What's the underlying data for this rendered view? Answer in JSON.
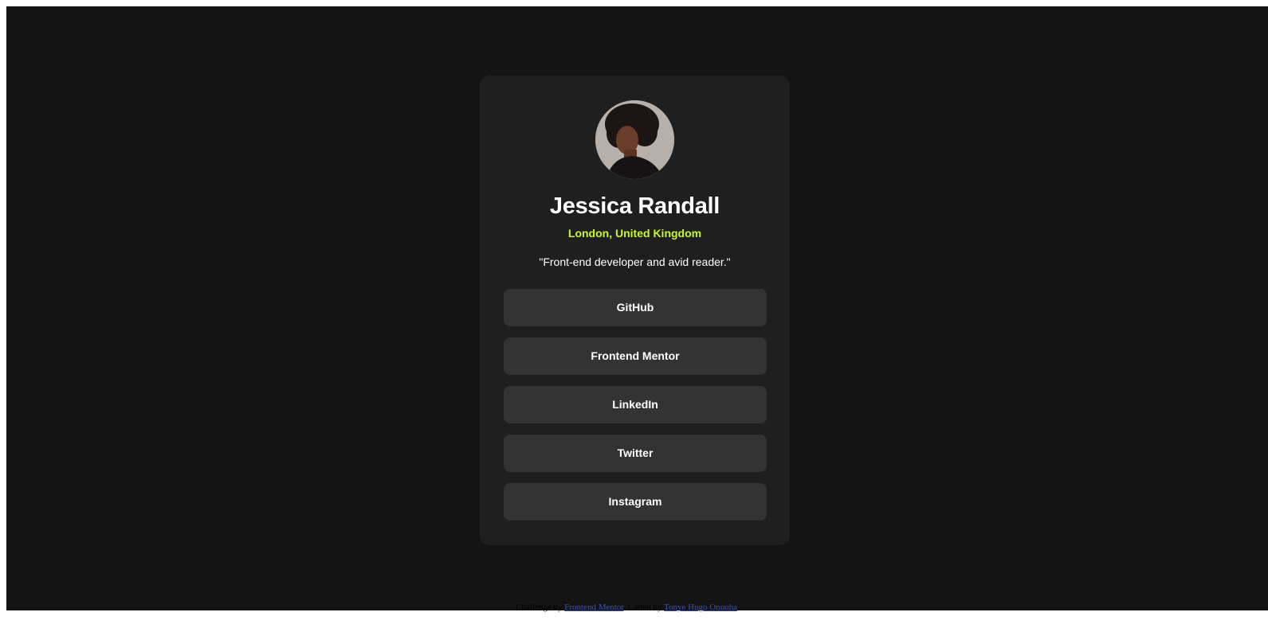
{
  "profile": {
    "name": "Jessica Randall",
    "location": "London, United Kingdom",
    "bio": "\"Front-end developer and avid reader.\""
  },
  "links": [
    {
      "label": "GitHub"
    },
    {
      "label": "Frontend Mentor"
    },
    {
      "label": "LinkedIn"
    },
    {
      "label": "Twitter"
    },
    {
      "label": "Instagram"
    }
  ],
  "footer": {
    "prefix": "Challenge by",
    "challenge_link": "Frontend Mentor",
    "middle": ". Coded by",
    "author_link": "Tonye Hugo Onuoha",
    "suffix": "."
  },
  "colors": {
    "page_background": "#141414",
    "card_background": "#1f1f1f",
    "button_background": "#333333",
    "accent": "#c5f82a",
    "text": "#ffffff"
  }
}
